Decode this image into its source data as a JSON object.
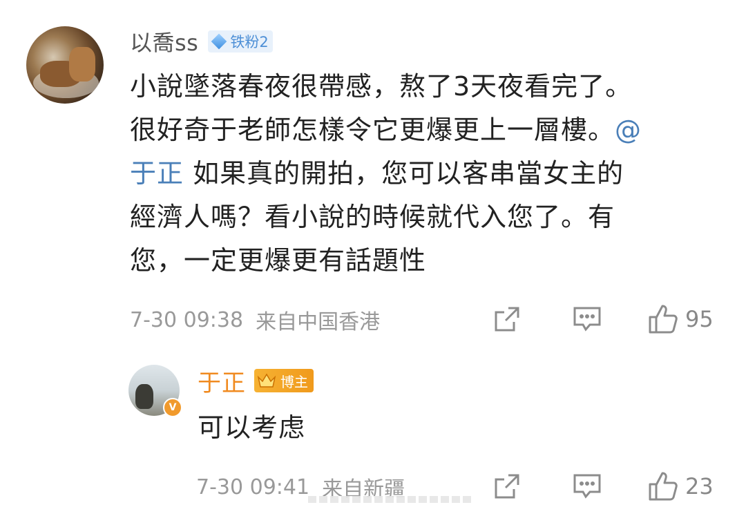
{
  "comment": {
    "username": "以喬ss",
    "badge_label": "铁粉2",
    "text_lines": [
      "小說墜落春夜很帶感，熬了3天夜看完了。",
      "很好奇于老師怎樣令它更爆更上一層樓。",
      "如果真的開拍，您可以客串當女主的",
      "經濟人嗎？看小說的時候就代入您了。有",
      "您，一定更爆更有話題性"
    ],
    "mention_start": "@",
    "mention_name": "于正",
    "time": "7-30 09:38",
    "location": "来自中国香港",
    "likes": "95"
  },
  "reply": {
    "username": "于正",
    "badge_label": "博主",
    "text": "可以考虑",
    "time": "7-30 09:41",
    "location": "来自新疆",
    "likes": "23",
    "verified_mark": "V"
  },
  "icons": {
    "share": "share-icon",
    "comment": "comment-icon",
    "like": "thumbs-up-icon",
    "diamond": "diamond-icon",
    "crown": "crown-icon"
  },
  "colors": {
    "mention": "#4a7fb8",
    "blogger_name": "#f08a1f",
    "meta_gray": "#999999"
  }
}
